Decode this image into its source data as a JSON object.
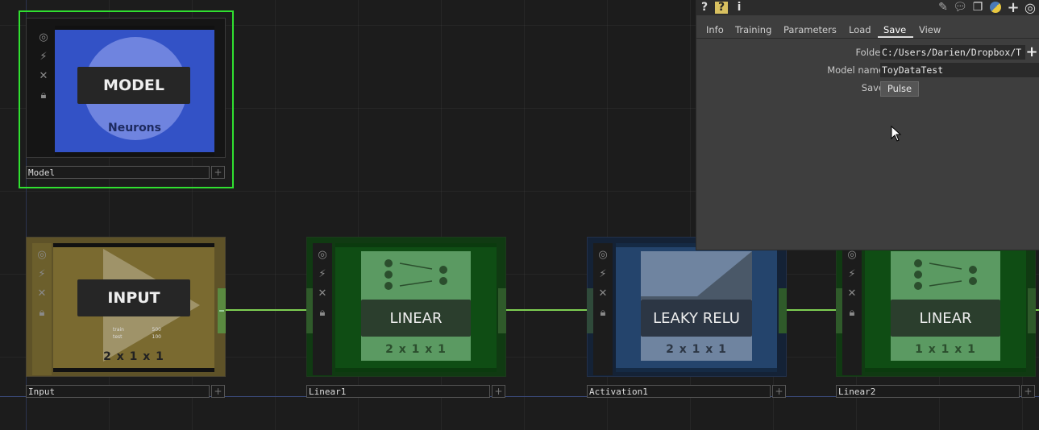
{
  "nodes": {
    "model": {
      "name": "Model",
      "title": "MODEL",
      "subtitle": "Neurons"
    },
    "input": {
      "name": "Input",
      "title": "INPUT",
      "dims": "2 x 1 x 1",
      "mini_rows": [
        [
          "train",
          "500"
        ],
        [
          "test",
          "100"
        ]
      ]
    },
    "linear1": {
      "name": "Linear1",
      "title": "LINEAR",
      "dims": "2 x 1 x 1"
    },
    "activation1": {
      "name": "Activation1",
      "title": "LEAKY RELU",
      "dims": "2 x 1 x 1"
    },
    "linear2": {
      "name": "Linear2",
      "title": "LINEAR",
      "dims": "1 x 1 x 1"
    }
  },
  "node_plus_glyph": "+",
  "panel": {
    "toolbar": {
      "help": "?",
      "python_help": "?",
      "info": "i"
    },
    "tabs": [
      "Info",
      "Training",
      "Parameters",
      "Load",
      "Save",
      "View"
    ],
    "active_tab": "Save",
    "params": {
      "folder_label": "Folder",
      "folder_value": "C:/Users/Darien/Dropbox/T",
      "model_name_label": "Model name",
      "model_name_value": "ToyDataTest",
      "save_label": "Save",
      "save_button": "Pulse"
    }
  },
  "colors": {
    "selection": "#30e030",
    "wire": "#7ecf52",
    "model_bg": "#3352c6",
    "input_bg": "#7a6a30",
    "linear_bg": "#1a6a1e",
    "relu_bg": "#24446c"
  }
}
